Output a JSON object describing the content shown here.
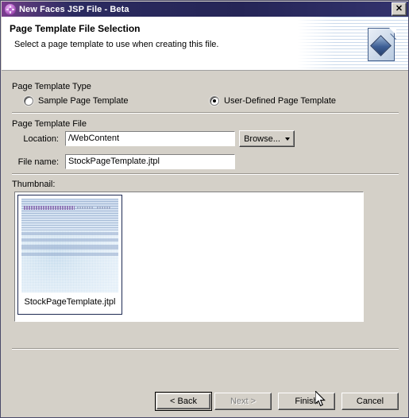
{
  "window": {
    "title": "New Faces JSP File - Beta",
    "title_icon": "faces-orb-icon",
    "close_label": "✕"
  },
  "header": {
    "title": "Page Template File Selection",
    "description": "Select a page template to use when creating this file.",
    "icon": "page-template-document-icon"
  },
  "sections": {
    "template_type": {
      "label": "Page Template Type",
      "options": [
        {
          "label": "Sample Page Template",
          "selected": false
        },
        {
          "label": "User-Defined Page Template",
          "selected": true
        }
      ]
    },
    "template_file": {
      "label": "Page Template File",
      "location_label": "Location:",
      "location_value": "/WebContent",
      "browse_label": "Browse...",
      "browse_icon": "chevron-down-icon",
      "filename_label": "File name:",
      "filename_value": "StockPageTemplate.jtpl"
    },
    "thumbnail": {
      "label": "Thumbnail:",
      "items": [
        {
          "label": "StockPageTemplate.jtpl",
          "selected": true
        }
      ]
    }
  },
  "buttons": {
    "back": "< Back",
    "next": "Next >",
    "finish": "Finish",
    "cancel": "Cancel"
  },
  "colors": {
    "dialog_face": "#d4d0c8",
    "titlebar_start": "#7b3d8f",
    "titlebar_end": "#33336e",
    "header_background": "#ffffff",
    "selection_border": "#1e2a52",
    "disabled_text": "#808080"
  }
}
